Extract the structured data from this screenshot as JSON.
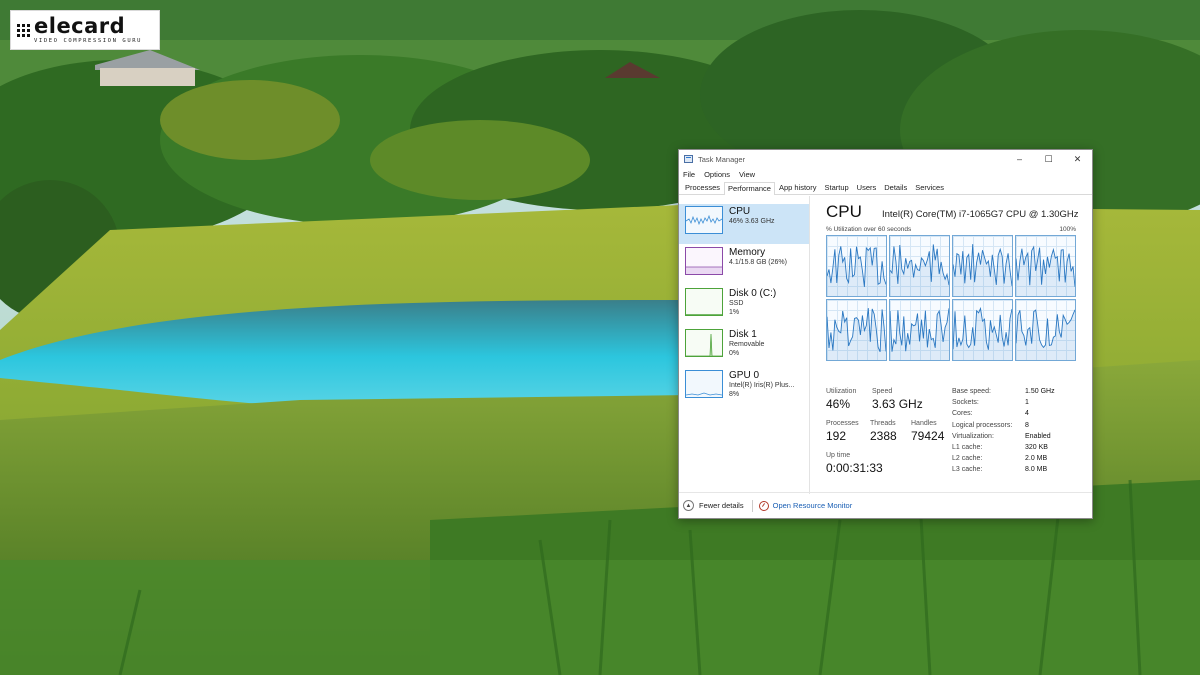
{
  "logo": {
    "name": "elecard",
    "tagline": "VIDEO COMPRESSION GURU"
  },
  "window": {
    "title": "Task Manager",
    "controls": {
      "minimize": "–",
      "maximize": "☐",
      "close": "✕"
    },
    "menu": [
      "File",
      "Options",
      "View"
    ],
    "tabs": [
      "Processes",
      "Performance",
      "App history",
      "Startup",
      "Users",
      "Details",
      "Services"
    ],
    "active_tab": "Performance"
  },
  "sidebar": {
    "items": [
      {
        "name": "CPU",
        "line1": "46% 3.63 GHz",
        "line2": "",
        "color": "#3b8ed6",
        "selected": true
      },
      {
        "name": "Memory",
        "line1": "4.1/15.8 GB (26%)",
        "line2": "",
        "color": "#8b4aa8"
      },
      {
        "name": "Disk 0 (C:)",
        "line1": "SSD",
        "line2": "1%",
        "color": "#4da33a"
      },
      {
        "name": "Disk 1",
        "line1": "Removable",
        "line2": "0%",
        "color": "#4da33a"
      },
      {
        "name": "GPU 0",
        "line1": "Intel(R) Iris(R) Plus...",
        "line2": "8%",
        "color": "#3b8ed6"
      }
    ]
  },
  "main": {
    "title": "CPU",
    "cpu_model": "Intel(R) Core(TM) i7-1065G7 CPU @ 1.30GHz",
    "graph_caption_left": "% Utilization over 60 seconds",
    "graph_caption_right": "100%",
    "graph_color": "#2b78c2",
    "stats": {
      "utilization_label": "Utilization",
      "utilization": "46%",
      "speed_label": "Speed",
      "speed": "3.63 GHz",
      "processes_label": "Processes",
      "processes": "192",
      "threads_label": "Threads",
      "threads": "2388",
      "handles_label": "Handles",
      "handles": "79424",
      "uptime_label": "Up time",
      "uptime": "0:00:31:33"
    },
    "specs": [
      {
        "k": "Base speed:",
        "v": "1.50 GHz"
      },
      {
        "k": "Sockets:",
        "v": "1"
      },
      {
        "k": "Cores:",
        "v": "4"
      },
      {
        "k": "Logical processors:",
        "v": "8"
      },
      {
        "k": "Virtualization:",
        "v": "Enabled"
      },
      {
        "k": "L1 cache:",
        "v": "320 KB"
      },
      {
        "k": "L2 cache:",
        "v": "2.0 MB"
      },
      {
        "k": "L3 cache:",
        "v": "8.0 MB"
      }
    ]
  },
  "footer": {
    "fewer_details": "Fewer details",
    "open_resource_monitor": "Open Resource Monitor"
  }
}
